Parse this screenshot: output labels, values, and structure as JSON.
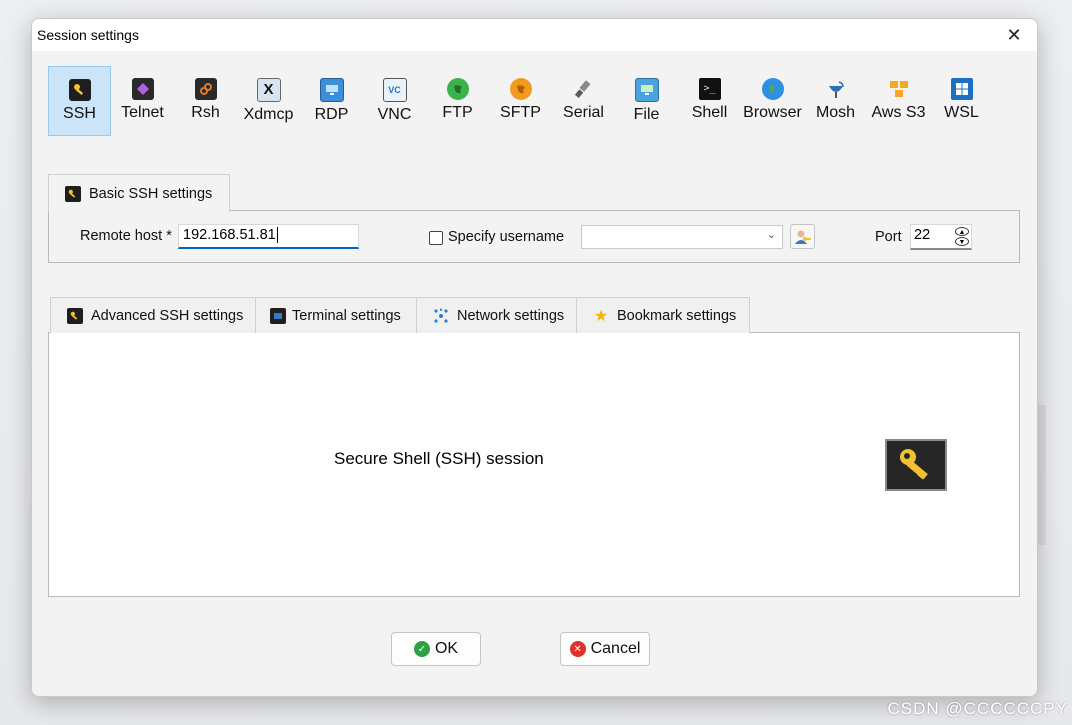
{
  "window": {
    "title": "Session settings"
  },
  "session_types": [
    {
      "label": "SSH",
      "icon": "key-icon",
      "selected": true
    },
    {
      "label": "Telnet",
      "icon": "telnet-icon"
    },
    {
      "label": "Rsh",
      "icon": "rsh-icon"
    },
    {
      "label": "Xdmcp",
      "icon": "xdmcp-icon"
    },
    {
      "label": "RDP",
      "icon": "rdp-icon"
    },
    {
      "label": "VNC",
      "icon": "vnc-icon"
    },
    {
      "label": "FTP",
      "icon": "ftp-icon"
    },
    {
      "label": "SFTP",
      "icon": "sftp-icon"
    },
    {
      "label": "Serial",
      "icon": "serial-icon"
    },
    {
      "label": "File",
      "icon": "file-icon"
    },
    {
      "label": "Shell",
      "icon": "shell-icon"
    },
    {
      "label": "Browser",
      "icon": "browser-icon"
    },
    {
      "label": "Mosh",
      "icon": "mosh-icon"
    },
    {
      "label": "Aws S3",
      "icon": "aws-s3-icon"
    },
    {
      "label": "WSL",
      "icon": "wsl-icon"
    }
  ],
  "basic": {
    "tab_label": "Basic SSH settings",
    "remote_host_label": "Remote host *",
    "remote_host_value": "192.168.51.81",
    "specify_username_label": "Specify username",
    "username_value": "",
    "port_label": "Port",
    "port_value": "22"
  },
  "lower_tabs": [
    {
      "label": "Advanced SSH settings",
      "icon": "key-icon"
    },
    {
      "label": "Terminal settings",
      "icon": "terminal-icon"
    },
    {
      "label": "Network settings",
      "icon": "network-icon"
    },
    {
      "label": "Bookmark settings",
      "icon": "star-icon"
    }
  ],
  "description": "Secure Shell (SSH) session",
  "buttons": {
    "ok": "OK",
    "cancel": "Cancel"
  },
  "watermark": "CSDN @CCCCCCPY",
  "colors": {
    "selected_bg": "#cce4f7",
    "accent": "#0067c0",
    "key_yellow": "#f2c12e",
    "ok_green": "#2ea043",
    "cancel_red": "#e0312b"
  }
}
